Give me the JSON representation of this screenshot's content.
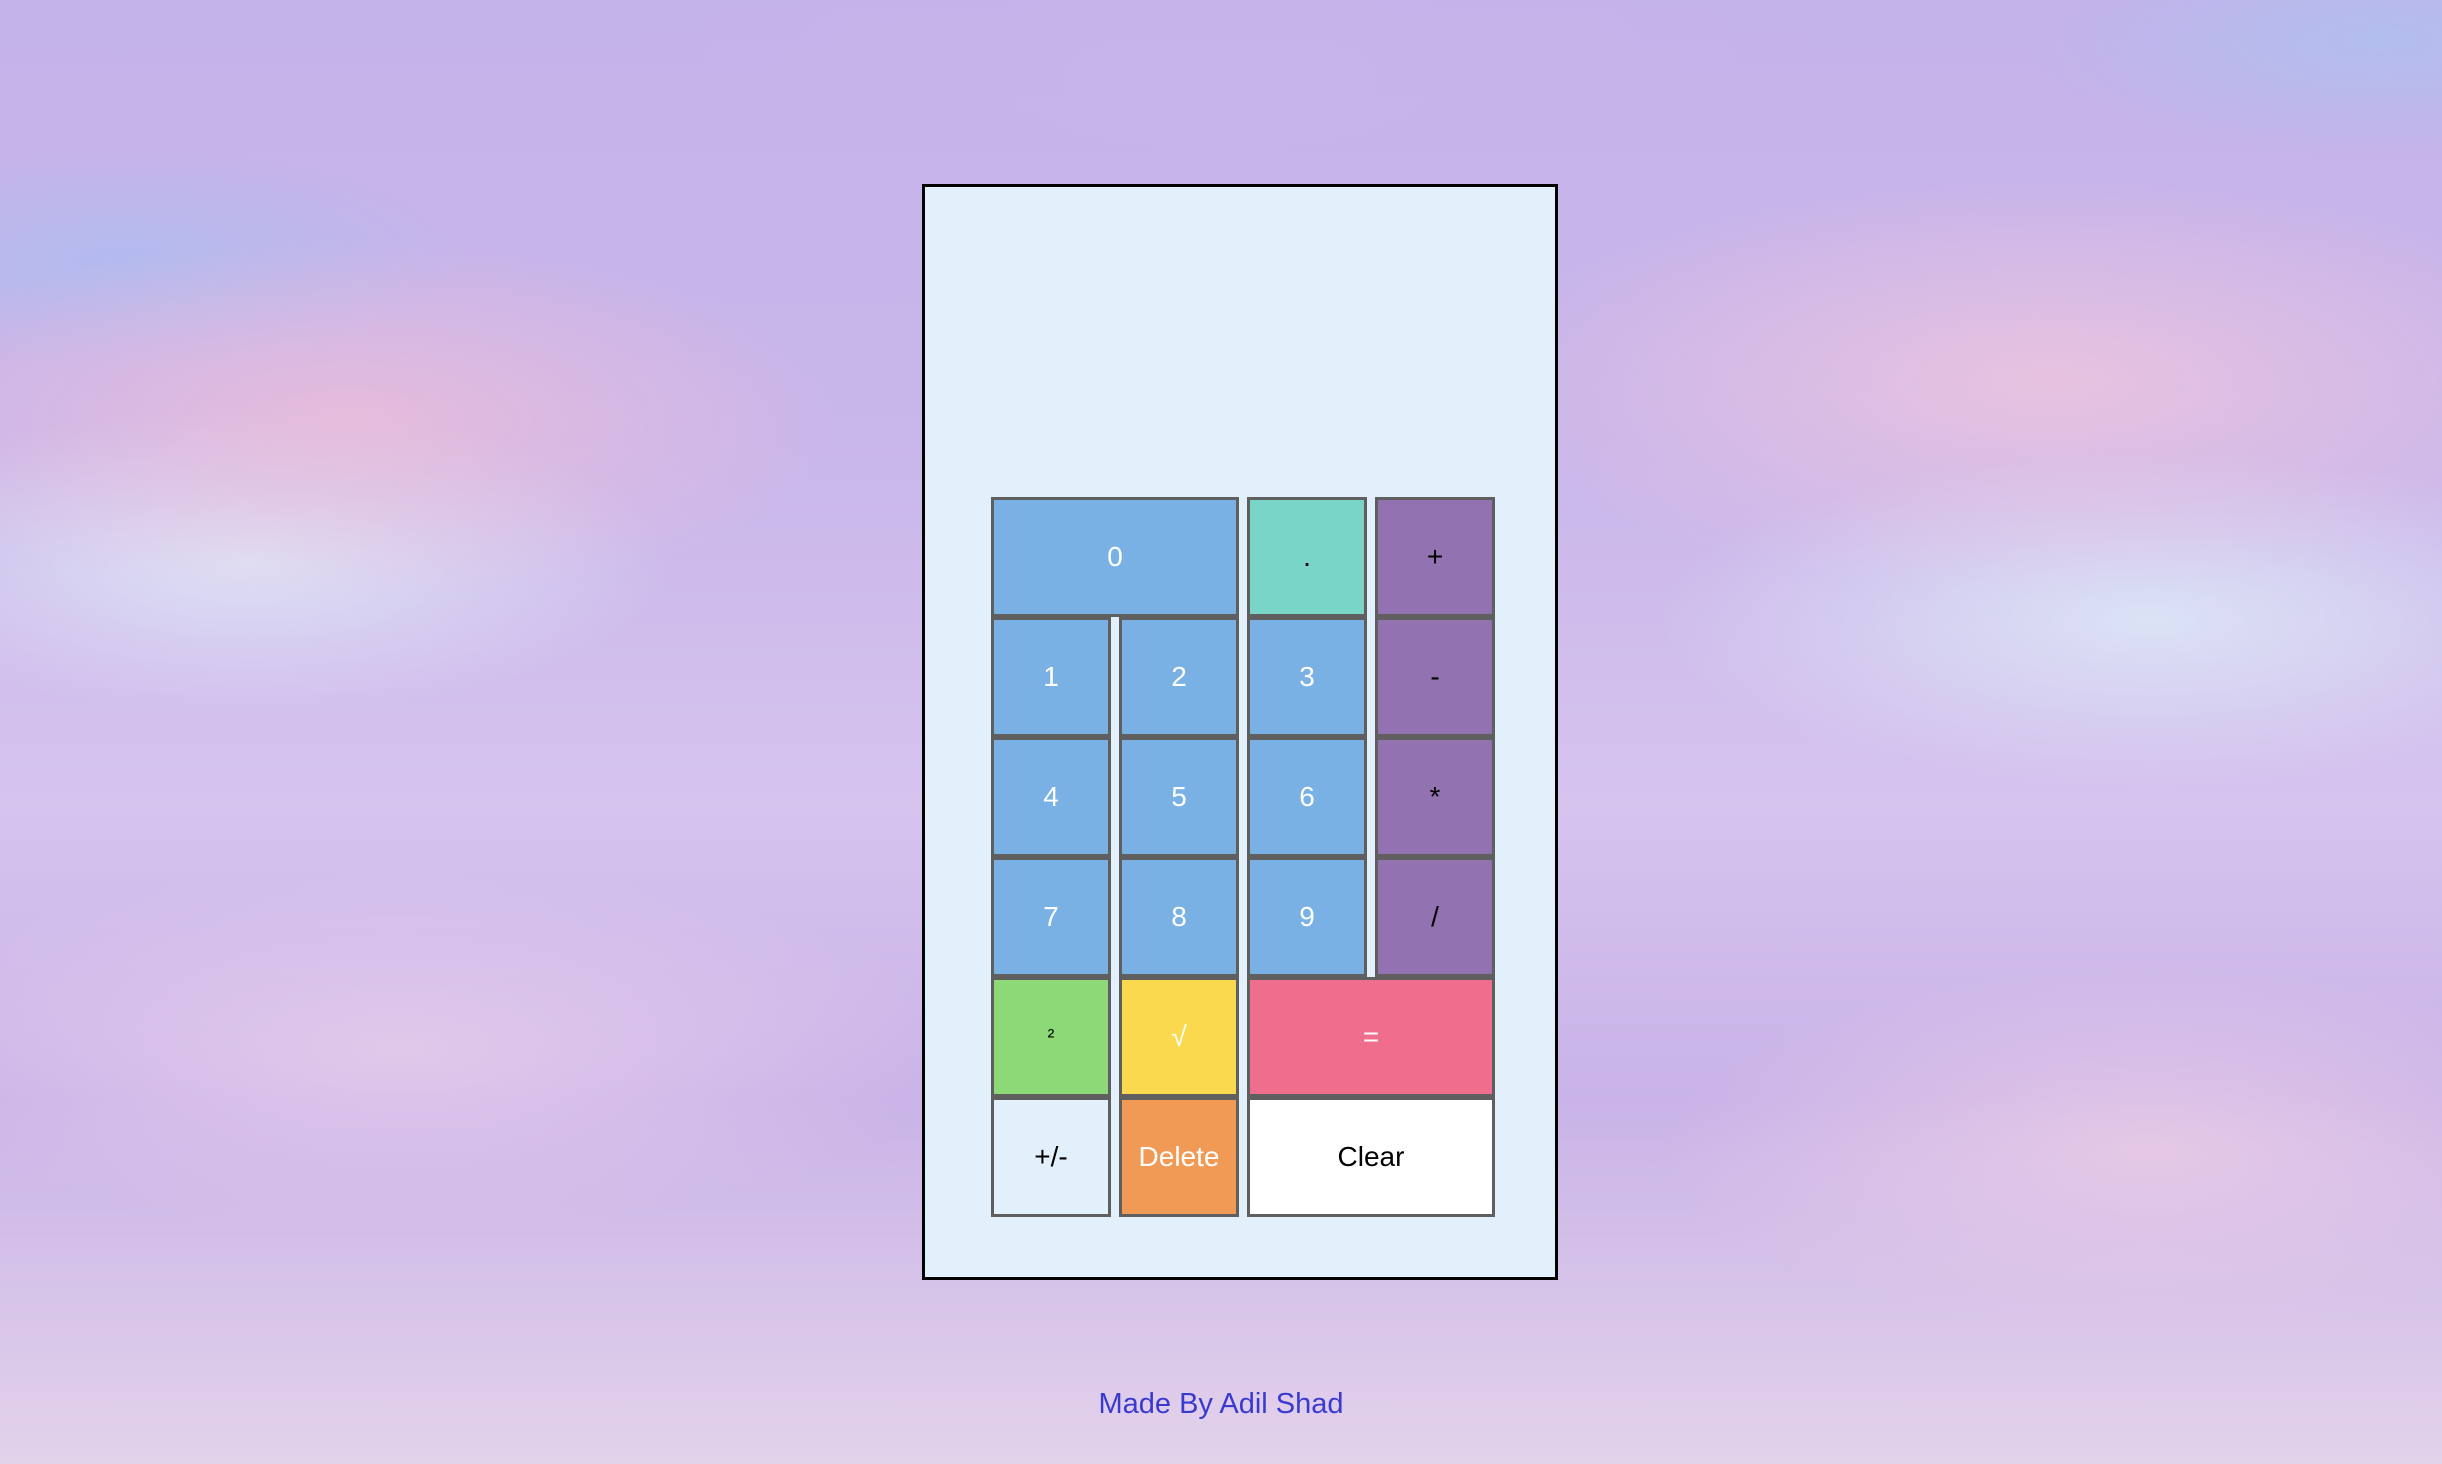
{
  "calculator": {
    "display_value": "",
    "buttons": {
      "zero": "0",
      "dot": ".",
      "plus": "+",
      "one": "1",
      "two": "2",
      "three": "3",
      "minus": "-",
      "four": "4",
      "five": "5",
      "six": "6",
      "multiply": "*",
      "seven": "7",
      "eight": "8",
      "nine": "9",
      "divide": "/",
      "square": "²",
      "sqrt": "√",
      "equals": "=",
      "negate": "+/-",
      "delete": "Delete",
      "clear": "Clear"
    }
  },
  "colors": {
    "number_button": "#7ab1e4",
    "dot_button": "#79d5c7",
    "operator_button": "#9372b1",
    "square_button": "#8dd978",
    "sqrt_button": "#fad94e",
    "equals_button": "#ef6e8e",
    "delete_button": "#f19a55",
    "calculator_body": "#e1f0fb",
    "footer_text": "#3a3acf"
  },
  "footer": {
    "credit": "Made By Adil Shad"
  }
}
